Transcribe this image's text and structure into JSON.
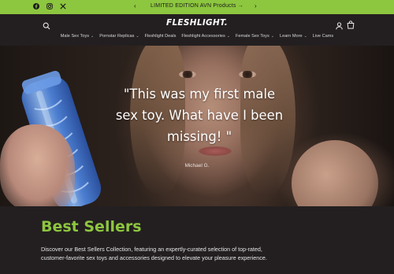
{
  "announcement": {
    "text": "LIMITED EDITION AVN Products →",
    "prev_arrow": "‹",
    "next_arrow": "›",
    "social_icons": [
      "facebook-icon",
      "instagram-icon",
      "x-icon"
    ],
    "background_color": "#8dc63f"
  },
  "header": {
    "logo_text": "FLESHLIGHT.",
    "nav": [
      {
        "label": "Male Sex Toys",
        "has_dropdown": true
      },
      {
        "label": "Pornstar Replicas",
        "has_dropdown": true
      },
      {
        "label": "Fleshlight Deals",
        "has_dropdown": false
      },
      {
        "label": "Fleshlight Accessories",
        "has_dropdown": true
      },
      {
        "label": "Female Sex Toys",
        "has_dropdown": true
      },
      {
        "label": "Learn More",
        "has_dropdown": true
      },
      {
        "label": "Live Cams",
        "has_dropdown": false
      }
    ],
    "icons": [
      "search-icon",
      "account-icon",
      "cart-icon"
    ]
  },
  "hero": {
    "quote": "\"This was my first male sex toy. What have I been missing! \"",
    "author": "Michael G."
  },
  "best_sellers": {
    "title": "Best Sellers",
    "description": "Discover our Best Sellers Collection, featuring an expertly-curated selection of top-rated, customer-favorite sex toys and accessories designed to elevate your pleasure experience.",
    "accent_color": "#8dc63f"
  }
}
